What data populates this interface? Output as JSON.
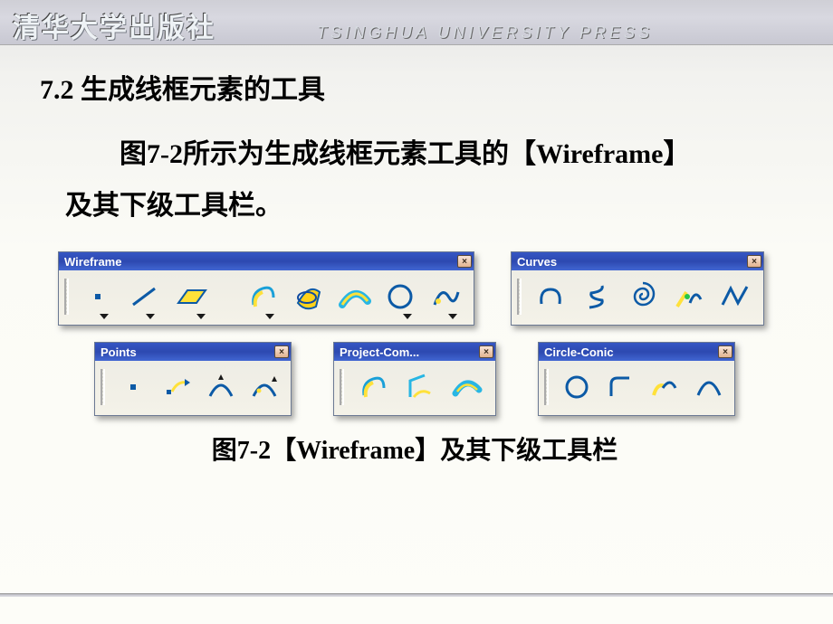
{
  "header": {
    "publisher_cn": "清华大学出版社",
    "publisher_en": "TSINGHUA UNIVERSITY PRESS"
  },
  "section": {
    "heading": "7.2 生成线框元素的工具",
    "body_line1": "图7-2所示为生成线框元素工具的【Wireframe】",
    "body_line2": "及其下级工具栏。",
    "caption": "图7-2【Wireframe】及其下级工具栏"
  },
  "toolbars": {
    "wireframe": {
      "title": "Wireframe",
      "close": "×",
      "tools": [
        "point",
        "line",
        "plane",
        "project",
        "sweep",
        "intersect",
        "circle",
        "curve-edit"
      ]
    },
    "curves": {
      "title": "Curves",
      "close": "×",
      "tools": [
        "spline",
        "helix",
        "spiral",
        "connect",
        "polyline"
      ]
    },
    "points": {
      "title": "Points",
      "close": "×",
      "tools": [
        "point",
        "point-ref",
        "extremum-1",
        "extremum-2"
      ]
    },
    "project": {
      "title": "Project-Com...",
      "close": "×",
      "tools": [
        "project",
        "combine",
        "reflect-line"
      ]
    },
    "circleconic": {
      "title": "Circle-Conic",
      "close": "×",
      "tools": [
        "circle",
        "corner",
        "connect-curve",
        "conic"
      ]
    }
  }
}
